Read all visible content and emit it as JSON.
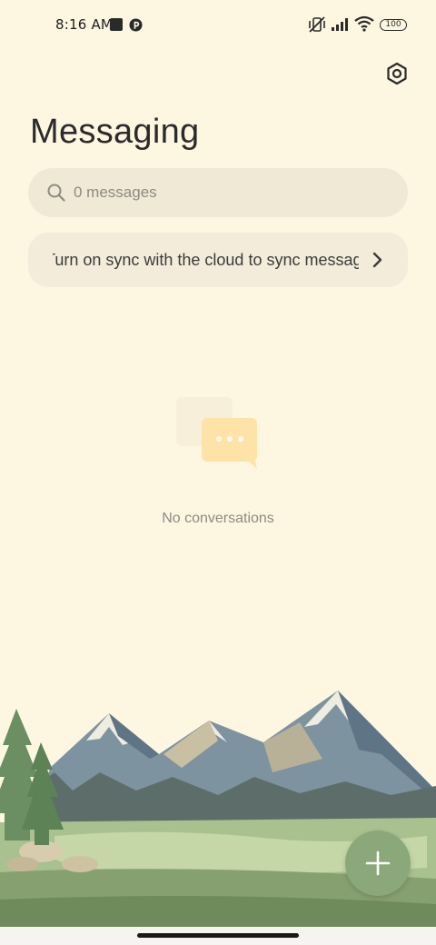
{
  "status_bar": {
    "time": "8:16 AM",
    "battery": "100",
    "icons": [
      "stop-square-icon",
      "app-notification-icon",
      "vibrate-off-icon",
      "signal-icon",
      "wifi-icon",
      "battery-icon"
    ]
  },
  "header": {
    "title": "Messaging",
    "settings_icon": "settings-hexagon-icon"
  },
  "search": {
    "placeholder": "0 messages",
    "value": ""
  },
  "sync_banner": {
    "text": "Turn on sync with the cloud to sync messages"
  },
  "empty_state": {
    "text": "No conversations",
    "icon": "chat-bubbles-icon"
  },
  "fab": {
    "icon": "plus-icon"
  },
  "colors": {
    "background": "#fdf7e1",
    "search_bg": "#f0e9d6",
    "fab": "#8aa87a",
    "bubble": "#fde3a8"
  }
}
